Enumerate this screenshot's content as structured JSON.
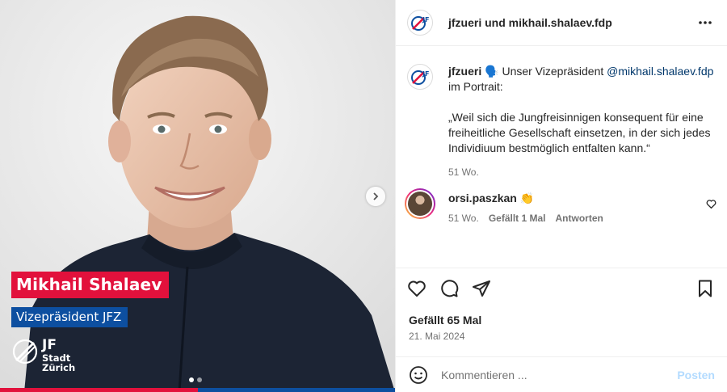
{
  "media": {
    "name_tag": "Mikhail Shalaev",
    "role_tag": "Vizepräsident JFZ",
    "logo": {
      "big": "JF",
      "line1": "Stadt",
      "line2": "Zürich"
    },
    "colors": {
      "red": "#e2113c",
      "blue": "#0d4fa0"
    },
    "carousel": {
      "total": 2,
      "current": 1
    }
  },
  "header": {
    "title": "jfzueri und mikhail.shalaev.fdp",
    "more_icon": "more-horizontal-icon"
  },
  "caption": {
    "user": "jfzueri",
    "emoji": "🗣️",
    "text_before": " Unser Vizepräsident ",
    "mention": "@mikhail.shalaev.fdp",
    "text_after": " im Portrait:",
    "quote": "„Weil sich die Jungfreisinnigen konsequent für eine freiheitliche Gesellschaft einsetzen, in der sich jedes Individiuum bestmöglich entfalten kann.“",
    "time": "51 Wo."
  },
  "comment": {
    "user": "orsi.paszkan",
    "text": "👏",
    "time": "51 Wo.",
    "likes": "Gefällt 1 Mal",
    "reply": "Antworten"
  },
  "actions": {
    "likes": "Gefällt 65 Mal",
    "date": "21. Mai 2024"
  },
  "comment_box": {
    "placeholder": "Kommentieren ...",
    "post_label": "Posten"
  }
}
